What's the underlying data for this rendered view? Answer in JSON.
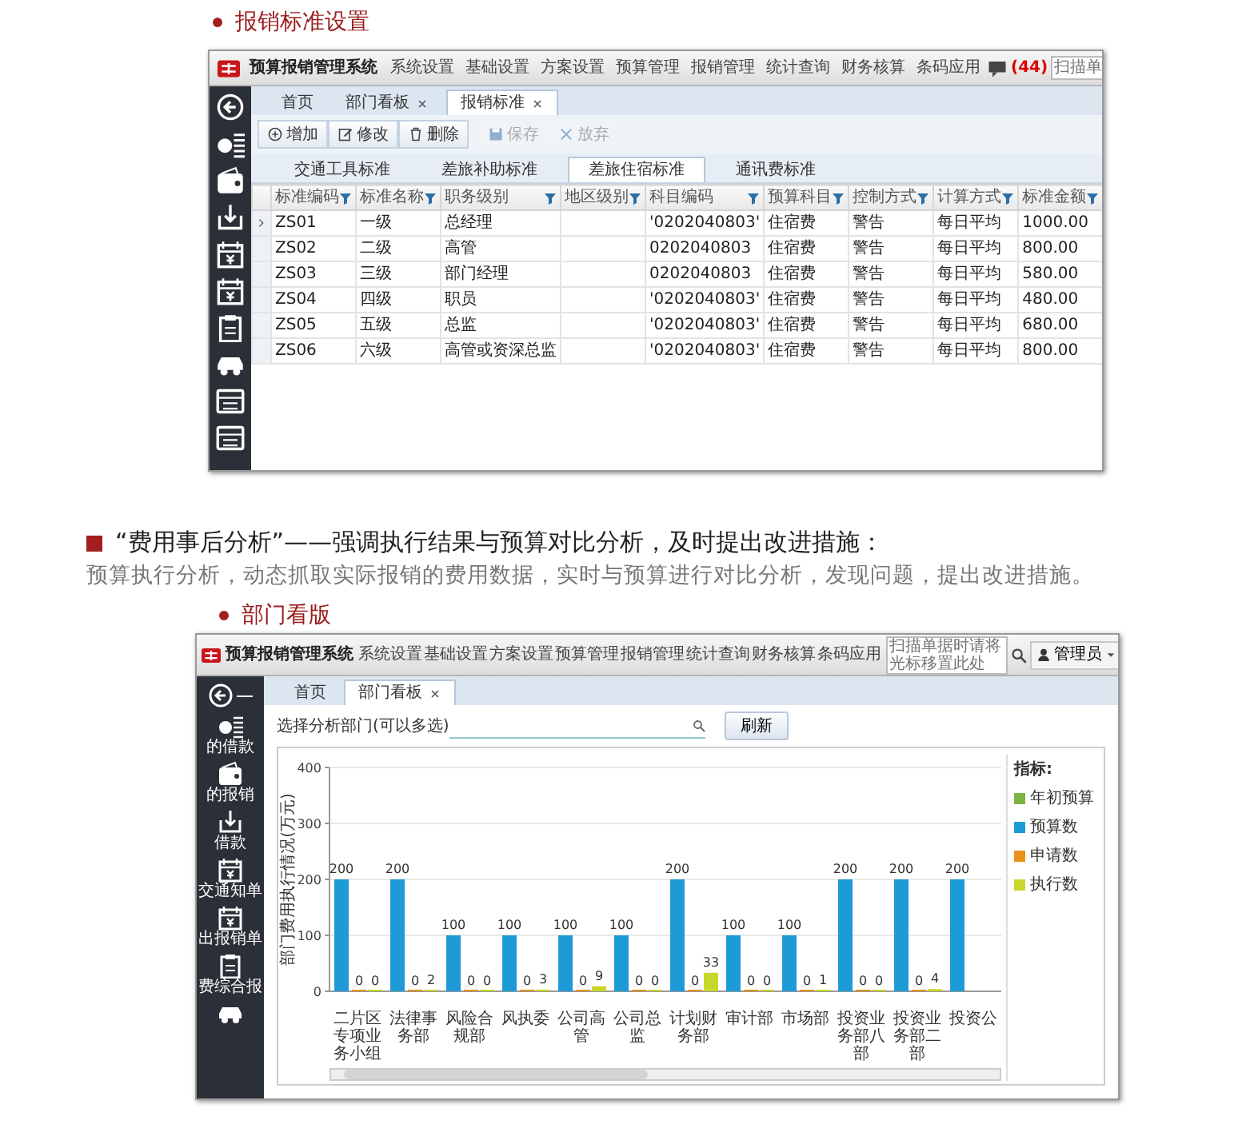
{
  "section_1": {
    "title": "报销标准设置"
  },
  "app_1": {
    "app_title": "预算报销管理系统",
    "menu": [
      "系统设置",
      "基础设置",
      "方案设置",
      "预算管理",
      "报销管理",
      "统计查询",
      "财务核算",
      "条码应用"
    ],
    "message_count": "(44)",
    "scan_field": {
      "placeholder": "扫描单"
    },
    "tabs": [
      {
        "label": "首页",
        "closable": false,
        "selected": false
      },
      {
        "label": "部门看板",
        "closable": true,
        "selected": false
      },
      {
        "label": "报销标准",
        "closable": true,
        "selected": true
      }
    ],
    "toolbar": [
      {
        "label": "增加",
        "kind": "add",
        "disabled": false
      },
      {
        "label": "修改",
        "kind": "edit",
        "disabled": false
      },
      {
        "label": "删除",
        "kind": "delete",
        "disabled": false
      },
      {
        "label": "保存",
        "kind": "save",
        "disabled": true
      },
      {
        "label": "放弃",
        "kind": "cancel",
        "disabled": true
      }
    ],
    "subtabs": [
      {
        "label": "交通工具标准",
        "selected": false
      },
      {
        "label": "差旅补助标准",
        "selected": false
      },
      {
        "label": "差旅住宿标准",
        "selected": true
      },
      {
        "label": "通讯费标准",
        "selected": false
      }
    ],
    "table": {
      "columns": [
        "标准编码",
        "标准名称",
        "职务级别",
        "地区级别",
        "科目编码",
        "预算科目",
        "控制方式",
        "计算方式",
        "标准金额"
      ],
      "rows": [
        {
          "current": true,
          "cells": [
            "ZS01",
            "一级",
            "总经理",
            null,
            "'0202040803'",
            "住宿费",
            "警告",
            "每日平均",
            "1000.00"
          ]
        },
        {
          "current": false,
          "cells": [
            "ZS02",
            "二级",
            "高管",
            null,
            "0202040803",
            "住宿费",
            "警告",
            "每日平均",
            "800.00"
          ]
        },
        {
          "current": false,
          "cells": [
            "ZS03",
            "三级",
            "部门经理",
            null,
            "0202040803",
            "住宿费",
            "警告",
            "每日平均",
            "580.00"
          ]
        },
        {
          "current": false,
          "cells": [
            "ZS04",
            "四级",
            "职员",
            null,
            "'0202040803'",
            "住宿费",
            "警告",
            "每日平均",
            "480.00"
          ]
        },
        {
          "current": false,
          "cells": [
            "ZS05",
            "五级",
            "总监",
            null,
            "'0202040803'",
            "住宿费",
            "警告",
            "每日平均",
            "680.00"
          ]
        },
        {
          "current": false,
          "cells": [
            "ZS06",
            "六级",
            "高管或资深总监",
            null,
            "'0202040803'",
            "住宿费",
            "警告",
            "每日平均",
            "800.00"
          ]
        }
      ]
    }
  },
  "section_2": {
    "heading": "“费用事后分析”——强调执行结果与预算对比分析，及时提出改进措施：",
    "text": "预算执行分析，动态抓取实际报销的费用数据，实时与预算进行对比分析，发现问题，提出改进措施。",
    "subtitle": "部门看版"
  },
  "app_2": {
    "app_title": "预算报销管理系统",
    "menu": [
      "系统设置",
      "基础设置",
      "方案设置",
      "预算管理",
      "报销管理",
      "统计查询",
      "财务核算",
      "条码应用"
    ],
    "search": {
      "placeholder": "扫描单据时请将光标移置此处"
    },
    "user": "管理员",
    "sidebar": [
      "的借款",
      "的报销",
      "借款",
      "交通知单",
      "出报销单",
      "费综合报"
    ],
    "tabs": [
      {
        "label": "首页",
        "closable": false,
        "selected": false
      },
      {
        "label": "部门看板",
        "closable": true,
        "selected": true
      }
    ],
    "filter": {
      "label": "选择分析部门(可以多选)",
      "button": "刷新"
    },
    "legend_title": "指标:",
    "chart_data": {
      "type": "bar",
      "ylabel": "部门费用执行情况(万元)",
      "categories": [
        "二片区专项业务小组",
        "法律事务部",
        "风险合规部",
        "风执委",
        "公司高管",
        "公司总监",
        "计划财务部",
        "审计部",
        "市场部",
        "投资业务部八部",
        "投资业务部二部",
        "投资公"
      ],
      "series": [
        {
          "name": "年初预算",
          "color": "#7cb342",
          "values": [
            null,
            null,
            null,
            null,
            null,
            null,
            null,
            null,
            null,
            null,
            null,
            null
          ]
        },
        {
          "name": "预算数",
          "color": "#1e9bd7",
          "values": [
            200,
            200,
            100,
            100,
            100,
            100,
            200,
            100,
            100,
            200,
            200,
            200
          ]
        },
        {
          "name": "申请数",
          "color": "#e8901a",
          "values": [
            0,
            0,
            0,
            0,
            0,
            0,
            0,
            0,
            0,
            0,
            0,
            null
          ]
        },
        {
          "name": "执行数",
          "color": "#c9d72a",
          "values": [
            0,
            2,
            0,
            3,
            9,
            0,
            33,
            0,
            1,
            0,
            4,
            null
          ]
        }
      ],
      "ylim": [
        0,
        400
      ],
      "yticks": [
        0,
        100,
        200,
        300,
        400
      ],
      "data_labels": true,
      "grid": true,
      "legend": true
    }
  }
}
